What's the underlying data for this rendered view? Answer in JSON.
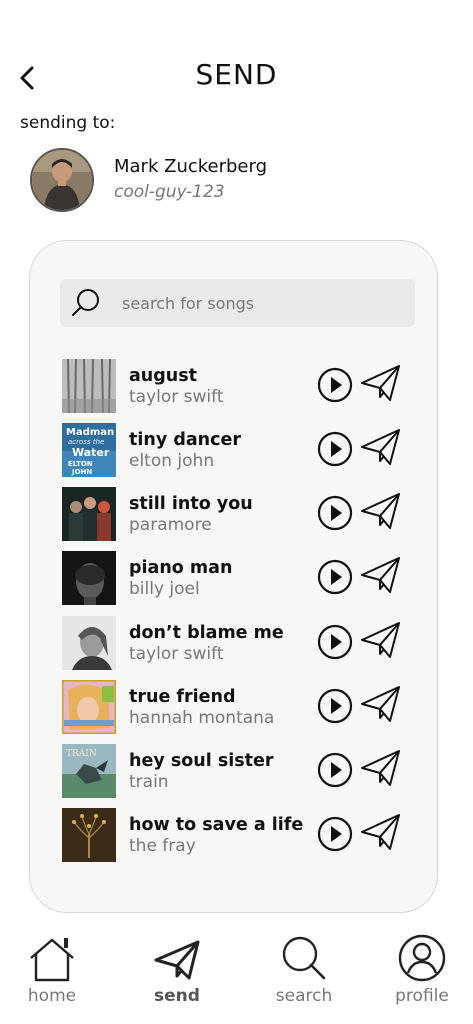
{
  "header": {
    "title": "SEND"
  },
  "recipient": {
    "label": "sending to:",
    "name": "Mark Zuckerberg",
    "handle": "cool-guy-123"
  },
  "search": {
    "placeholder": "search for songs"
  },
  "songs": [
    {
      "title": "august",
      "artist": "taylor swift"
    },
    {
      "title": "tiny dancer",
      "artist": "elton john",
      "cover_text": [
        "Madman",
        "across the",
        "Water",
        "ELTON",
        "JOHN"
      ]
    },
    {
      "title": "still into you",
      "artist": "paramore"
    },
    {
      "title": "piano man",
      "artist": "billy joel"
    },
    {
      "title": "don’t blame me",
      "artist": "taylor swift"
    },
    {
      "title": "true friend",
      "artist": "hannah montana"
    },
    {
      "title": "hey soul sister",
      "artist": "train",
      "cover_text": [
        "TRAIN"
      ]
    },
    {
      "title": "how to save a life",
      "artist": "the fray"
    }
  ],
  "nav": [
    {
      "label": "home",
      "icon": "home-icon"
    },
    {
      "label": "send",
      "icon": "send-icon",
      "active": true
    },
    {
      "label": "search",
      "icon": "search-icon"
    },
    {
      "label": "profile",
      "icon": "profile-icon"
    }
  ],
  "colors": {
    "panel_bg": "#f7f7f5",
    "search_bg": "#e9e9e7",
    "secondary_text": "#777777"
  }
}
